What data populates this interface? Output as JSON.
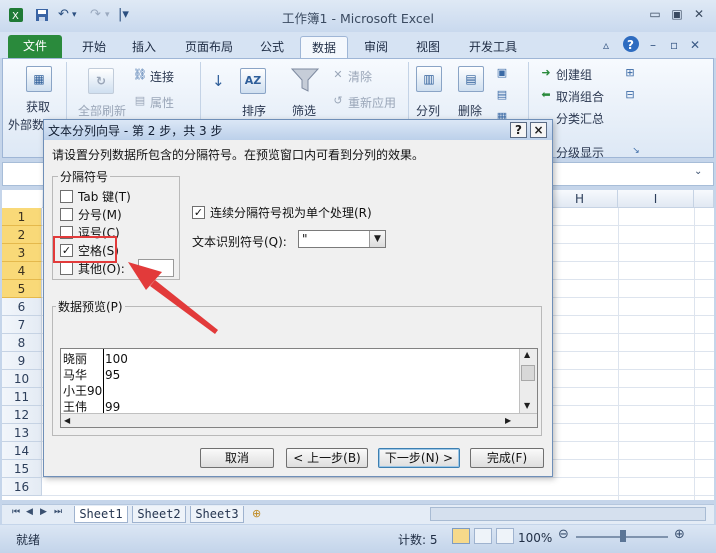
{
  "window": {
    "title": "工作簿1 - Microsoft Excel",
    "qa_icons": [
      "excel-logo-icon",
      "save-icon",
      "undo-icon",
      "redo-icon",
      "customize-qat-icon"
    ],
    "controls": [
      "minimize-icon",
      "restore-icon",
      "close-icon"
    ]
  },
  "ribbon_tabs": [
    "文件",
    "开始",
    "插入",
    "页面布局",
    "公式",
    "数据",
    "审阅",
    "视图",
    "开发工具"
  ],
  "ribbon": {
    "get_data": "获取",
    "external": "外部数",
    "refresh_all": "全部刷新",
    "connections": "连接",
    "properties": "属性",
    "sort_icon": "AZ",
    "sort": "排序",
    "filter": "筛选",
    "clear": "清除",
    "reapply": "重新应用",
    "text_to_columns": "分列",
    "remove_dup": "删除",
    "group": "创建组",
    "ungroup": "取消组合",
    "subtotal": "分类汇总",
    "outline": "分级显示"
  },
  "grid": {
    "columns_visible": [
      "H",
      "I"
    ],
    "rows": [
      "1",
      "2",
      "3",
      "4",
      "5",
      "6",
      "7",
      "8",
      "9",
      "10",
      "11",
      "12",
      "13",
      "14",
      "15",
      "16"
    ],
    "selected_rows": [
      "1",
      "2",
      "3",
      "4",
      "5"
    ]
  },
  "sheets": [
    "Sheet1",
    "Sheet2",
    "Sheet3"
  ],
  "status": {
    "ready": "就绪",
    "count": "计数: 5",
    "zoom": "100%"
  },
  "dialog": {
    "title": "文本分列向导 - 第 2 步，共 3 步",
    "help": "?",
    "close": "×",
    "instruction": "请设置分列数据所包含的分隔符号。在预览窗口内可看到分列的效果。",
    "delimiters_label": "分隔符号",
    "delimiters": [
      {
        "label": "Tab 键(T)",
        "checked": false
      },
      {
        "label": "分号(M)",
        "checked": false
      },
      {
        "label": "逗号(C)",
        "checked": false
      },
      {
        "label": "空格(S)",
        "checked": true
      },
      {
        "label": "其他(O):",
        "checked": false
      }
    ],
    "consecutive": "连续分隔符号视为单个处理(R)",
    "consecutive_checked": true,
    "qualifier_label": "文本识别符号(Q):",
    "qualifier_value": "\"",
    "preview_label": "数据预览(P)",
    "preview_rows": [
      [
        "晓丽",
        "100"
      ],
      [
        "马华",
        "95"
      ],
      [
        "小王90",
        ""
      ],
      [
        "王伟",
        "99"
      ]
    ],
    "buttons": {
      "cancel": "取消",
      "back": "< 上一步(B)",
      "next": "下一步(N) >",
      "finish": "完成(F)"
    }
  },
  "colors": {
    "file_tab": "#2a8a3c",
    "annotation": "#e23a3a",
    "selected_row_header": "#f9d978"
  }
}
